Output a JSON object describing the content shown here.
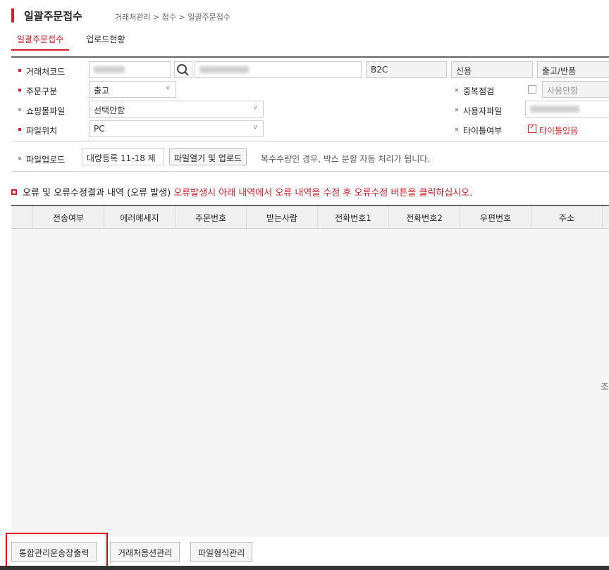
{
  "header": {
    "title": "일괄주문접수",
    "breadcrumb": "거래처관리 > 접수 > 일괄주문접수"
  },
  "tabs": [
    {
      "label": "일괄주문접수",
      "active": true
    },
    {
      "label": "업로드현황",
      "active": false
    }
  ],
  "form": {
    "client_code": {
      "label": "거래처코드",
      "value": "",
      "name_value": "",
      "type_value": "B2C",
      "credit_value": "신용",
      "shipping_value": "출고/반품"
    },
    "order_type": {
      "label": "주문구분",
      "value": "출고"
    },
    "dup_check": {
      "label": "중복점검",
      "value": "사용안함",
      "checked": false
    },
    "mall_file": {
      "label": "쇼핑몰파일",
      "value": "선택안함"
    },
    "user_file": {
      "label": "사용자파일",
      "value": ""
    },
    "file_location": {
      "label": "파일위치",
      "value": "PC"
    },
    "title_option": {
      "label": "타이틀여부",
      "value": "타이틀있음",
      "checked": true
    },
    "file_upload": {
      "label": "파일업로드",
      "format_value": "대량등록 11-18 제",
      "upload_button": "파일열기 및 업로드",
      "hint": "복수수량인 경우, 박스 분할 자동 처리가 됩니다."
    }
  },
  "error_section": {
    "title": "오류 및 오류수정결과 내역 (오류 발생)",
    "notice": "오류발생시 아래 내역에서 오류 내역을 수정 후 오류수정 버튼을 클릭하십시오."
  },
  "table": {
    "columns": [
      "전송여부",
      "에러메세지",
      "주문번호",
      "받는사람",
      "전화번호1",
      "전화번호2",
      "우편번호",
      "주소"
    ],
    "empty_text": "조"
  },
  "bottom_buttons": {
    "print_label": "통합관리운송장출력",
    "option_label": "거래처옵션관리",
    "format_label": "파일형식관리"
  },
  "colors": {
    "accent": "#d0202a",
    "highlight": "#ee0000"
  }
}
